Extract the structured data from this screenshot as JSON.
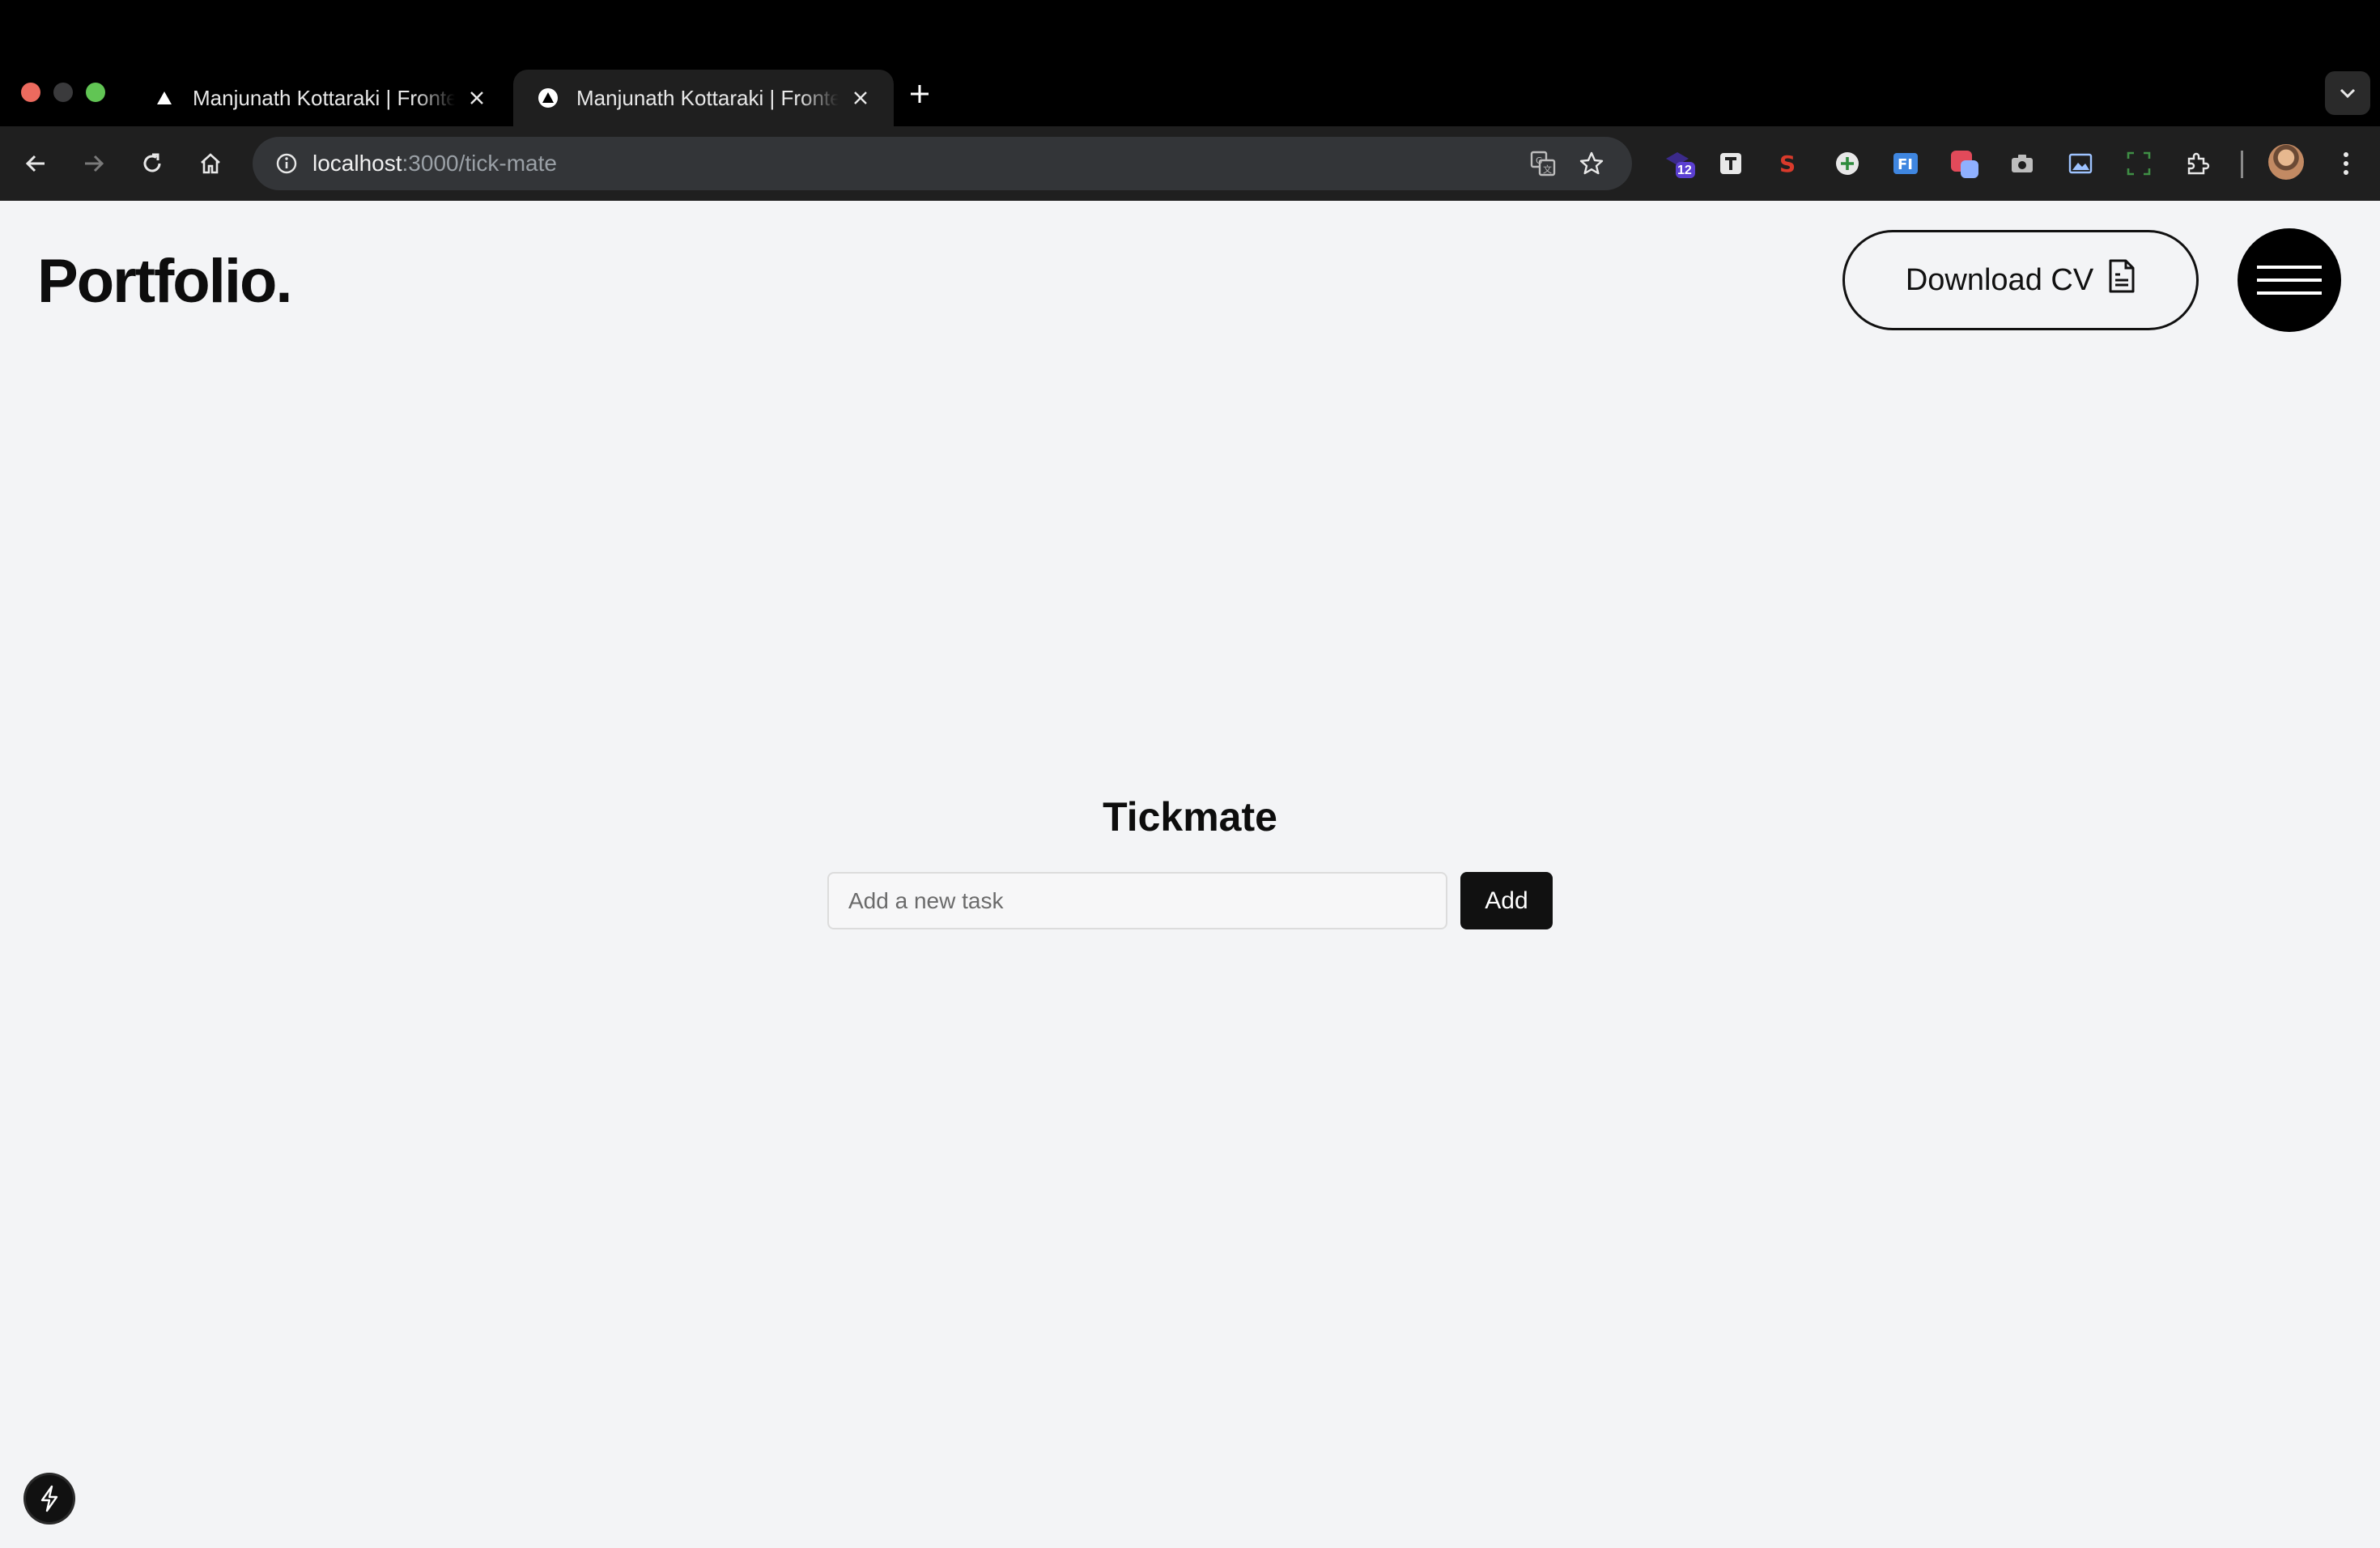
{
  "browser": {
    "tabs": [
      {
        "title": "Manjunath Kottaraki | Frontend Developer",
        "active": false
      },
      {
        "title": "Manjunath Kottaraki | Frontend Developer",
        "active": true
      }
    ],
    "url_host": "localhost",
    "url_path": ":3000/tick-mate",
    "extension_badge": "12",
    "icons": [
      "back-icon",
      "forward-icon",
      "reload-icon",
      "home-icon",
      "site-info-icon",
      "translate-icon",
      "bookmark-star-icon",
      "extensions-puzzle-icon",
      "more-menu-icon"
    ]
  },
  "header": {
    "logo": "Portfolio.",
    "download_label": "Download CV"
  },
  "app": {
    "title": "Tickmate",
    "input_placeholder": "Add a new task",
    "input_value": "",
    "add_label": "Add"
  },
  "colors": {
    "page_bg": "#f3f4f6",
    "accent": "#111111",
    "chrome_bg": "#000000",
    "toolbar_bg": "#1f1f1f"
  }
}
